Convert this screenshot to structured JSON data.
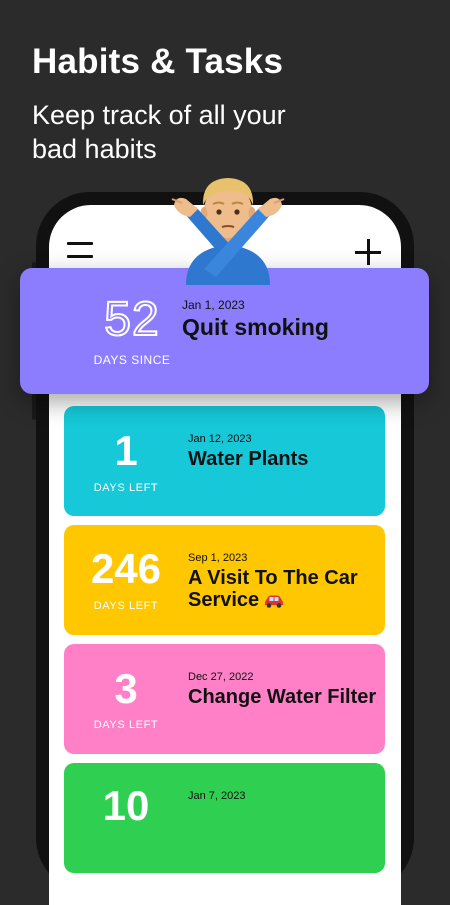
{
  "header": {
    "headline": "Habits & Tasks",
    "subline": "Keep track of all your bad habits"
  },
  "toolbar": {
    "menu_icon": "hamburger-menu-icon",
    "add_icon": "plus-icon"
  },
  "featured": {
    "count": "52",
    "caption": "DAYS SINCE",
    "date": "Jan 1, 2023",
    "title": "Quit smoking",
    "color": "#8c7dff"
  },
  "tasks": [
    {
      "count": "1",
      "caption": "DAYS LEFT",
      "date": "Jan 12, 2023",
      "title": "Water Plants",
      "color": "#16c8d8"
    },
    {
      "count": "246",
      "caption": "DAYS LEFT",
      "date": "Sep 1, 2023",
      "title": "A Visit To The Car Service",
      "icon": "red-car-emoji",
      "color": "#ffc700"
    },
    {
      "count": "3",
      "caption": "DAYS LEFT",
      "date": "Dec 27, 2022",
      "title": "Change Water Filter",
      "color": "#ff80c7"
    },
    {
      "count": "10",
      "date": "Jan 7, 2023",
      "color": "#2fd052"
    }
  ]
}
